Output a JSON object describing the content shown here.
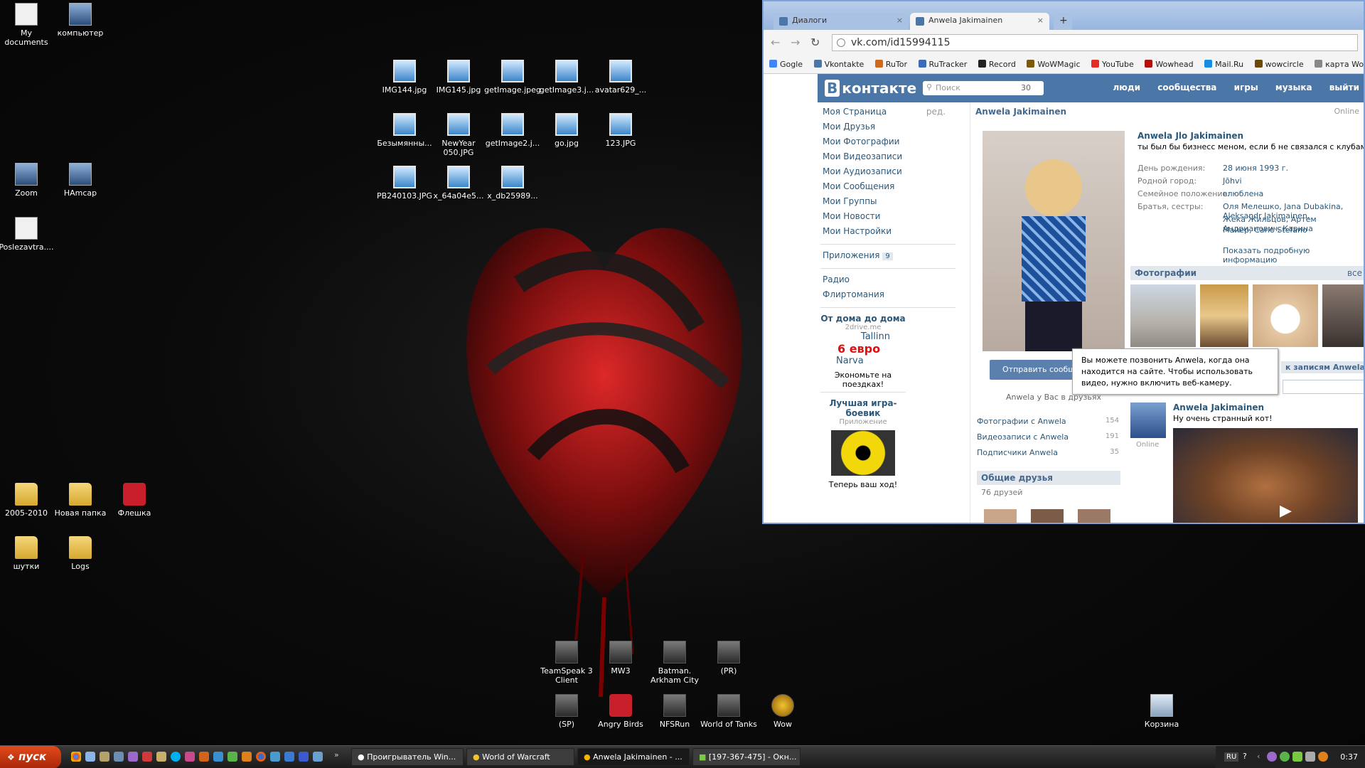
{
  "desktop": {
    "left_icons": [
      {
        "label": "My documents",
        "type": "doc"
      },
      {
        "label": "компьютер",
        "type": "gen"
      },
      {
        "label": "Zoom",
        "type": "gen"
      },
      {
        "label": "HAmcap",
        "type": "gen"
      },
      {
        "label": "Poslezavtra....",
        "type": "doc"
      },
      {
        "label": "2005-2010",
        "type": "folder"
      },
      {
        "label": "Новая папка",
        "type": "folder"
      },
      {
        "label": "Флешка",
        "type": "red"
      },
      {
        "label": "шутки",
        "type": "folder"
      },
      {
        "label": "Logs",
        "type": "folder"
      }
    ],
    "image_icons": [
      {
        "label": "IMG144.jpg"
      },
      {
        "label": "IMG145.jpg"
      },
      {
        "label": "getImage.jpeg"
      },
      {
        "label": "getImage3.j..."
      },
      {
        "label": "avatar629_..."
      },
      {
        "label": "Безымянны..."
      },
      {
        "label": "NewYear 050.JPG"
      },
      {
        "label": "getImage2.j..."
      },
      {
        "label": "go.jpg"
      },
      {
        "label": "123.JPG"
      },
      {
        "label": "PB240103.JPG"
      },
      {
        "label": "x_64a04e5..."
      },
      {
        "label": "x_db25989..."
      }
    ],
    "game_icons": [
      {
        "label": "TeamSpeak 3 Client"
      },
      {
        "label": "MW3"
      },
      {
        "label": "Batman. Arkham City"
      },
      {
        "label": "(PR)"
      },
      {
        "label": "(SP)"
      },
      {
        "label": "Angry Birds"
      },
      {
        "label": "NFSRun"
      },
      {
        "label": "World of Tanks"
      },
      {
        "label": "Wow"
      }
    ],
    "recycle_bin": "Корзина"
  },
  "browser": {
    "tabs": [
      {
        "label": "Диалоги",
        "close": "×"
      },
      {
        "label": "Anwela Jakimainen",
        "close": "×"
      }
    ],
    "new_tab": "+",
    "url": "vk.com/id15994115",
    "bookmarks": [
      {
        "label": "Gogle",
        "color": "#4285f4"
      },
      {
        "label": "Vkontakte",
        "color": "#4a76a8"
      },
      {
        "label": "RuTor",
        "color": "#d06a1a"
      },
      {
        "label": "RuTracker",
        "color": "#3b6cb5"
      },
      {
        "label": "Record",
        "color": "#222222"
      },
      {
        "label": "WoWMagic",
        "color": "#7a5a12"
      },
      {
        "label": "YouTube",
        "color": "#e52d27"
      },
      {
        "label": "Wowhead",
        "color": "#b31010"
      },
      {
        "label": "Mail.Ru",
        "color": "#168de2"
      },
      {
        "label": "wowcircle",
        "color": "#6b4a08"
      },
      {
        "label": "карта Wow",
        "color": "#888888"
      }
    ]
  },
  "vk": {
    "logo": "контакте",
    "logo_b": "В",
    "search_placeholder": "Поиск",
    "search_count": "30",
    "nav": [
      "люди",
      "сообщества",
      "игры",
      "музыка",
      "выйти"
    ],
    "menu": [
      "Моя Страница",
      "Мои Друзья",
      "Мои Фотографии",
      "Мои Видеозаписи",
      "Мои Аудиозаписи",
      "Мои Сообщения",
      "Мои Группы",
      "Мои Новости",
      "Мои Настройки"
    ],
    "edit": "ред.",
    "apps": "Приложения",
    "apps_count": "9",
    "extra": [
      "Радио",
      "Флиртомания"
    ],
    "ad1": {
      "title": "От дома до дома",
      "site": "2drive.me",
      "city1": "Tallinn",
      "price": "6 евро",
      "city2": "Narva",
      "text": "Экономьте на поездках!"
    },
    "ad2": {
      "title": "Лучшая игра-боевик",
      "sub": "Приложение",
      "text": "Теперь ваш ход!"
    },
    "profile_name": "Anwela Jakimainen",
    "online": "Online",
    "full_name": "Anwela Jlo Jakimainen",
    "status": "ты был бы бизнесс меном, если б не связался с клубами, планом и феном...",
    "info": [
      {
        "k": "День рождения:",
        "v": "28 июня 1993 г."
      },
      {
        "k": "Родной город:",
        "v": "Jõhvi"
      },
      {
        "k": "Семейное положение:",
        "v": "влюблена"
      },
      {
        "k": "Братья, сестры:",
        "v": "Оля Мелешко, Jana Dubakina, Aleksandr Jakimainen,"
      },
      {
        "k": "",
        "v": "Жека Жильцов, Артем Андрианович, Карина"
      },
      {
        "k": "",
        "v": "Майер, Carlo Stefano"
      }
    ],
    "more_info": "Показать подробную информацию",
    "photos_title": "Фотографии",
    "photos_all": "все",
    "send_msg": "Отправить сообщение",
    "in_friends": "Anwela у Вас в друзьях",
    "links": [
      {
        "label": "Фотографии с Anwela",
        "n": "154"
      },
      {
        "label": "Видеозаписи с Anwela",
        "n": "191"
      },
      {
        "label": "Подписчики Anwela",
        "n": "35"
      }
    ],
    "common_friends": "Общие друзья",
    "friends_count": "76 друзей",
    "tooltip": "Вы можете позвонить Anwela, когда она находится на сайте. Чтобы использовать видео, нужно включить веб-камеру.",
    "wall_link": "к записям Anwela",
    "post_author": "Anwela Jakimainen",
    "post_text": "Ну очень странный кот!",
    "post_online": "Online"
  },
  "taskbar": {
    "start": "пуск",
    "items": [
      {
        "label": "Проигрыватель Win..."
      },
      {
        "label": "World of Warcraft"
      },
      {
        "label": "Anwela Jakimainen - ..."
      },
      {
        "label": "[197-367-475] - Окн..."
      }
    ],
    "lang": "RU",
    "clock": "0:37"
  }
}
